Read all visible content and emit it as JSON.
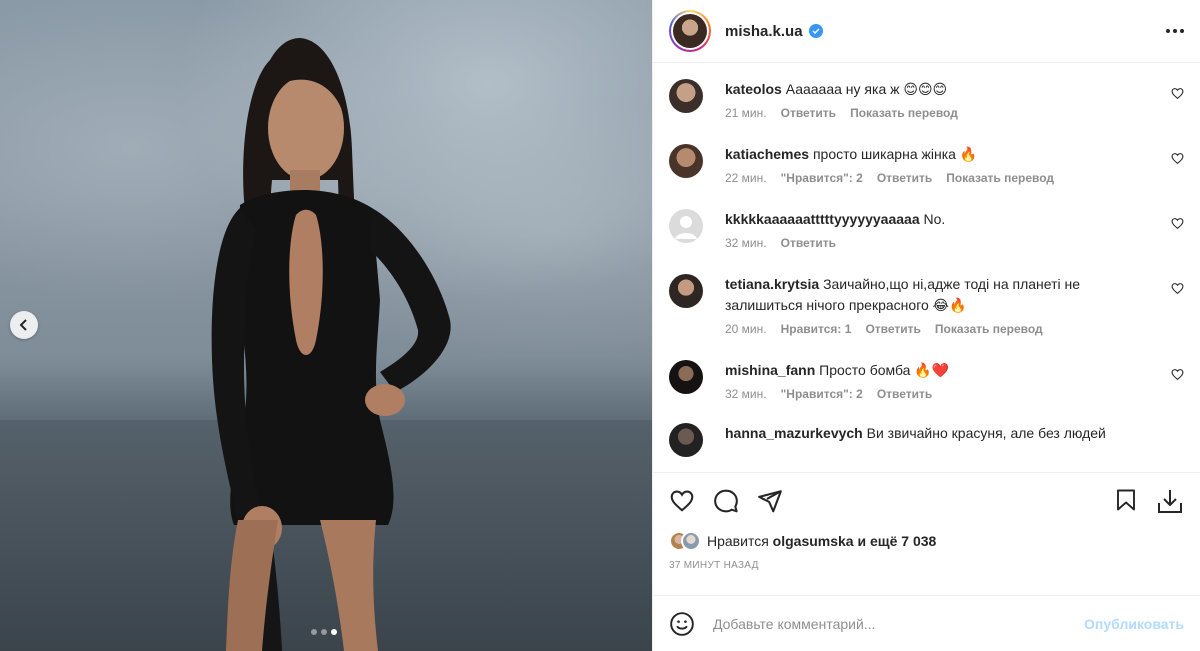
{
  "post": {
    "username": "misha.k.ua",
    "verified": true
  },
  "carousel": {
    "total": 3,
    "active": 3
  },
  "comments": [
    {
      "user": "kateolos",
      "text": "Ааааааа ну яка ж 😊😊😊",
      "time": "21 мин.",
      "likes_label": "",
      "reply": "Ответить",
      "translate": "Показать перевод"
    },
    {
      "user": "katiachemes",
      "text": "просто шикарна жінка 🔥",
      "time": "22 мин.",
      "likes_label": "\"Нравится\": 2",
      "reply": "Ответить",
      "translate": "Показать перевод"
    },
    {
      "user": "kkkkkaaaaaatttttyyyyyyaaaaa",
      "text": "No.",
      "time": "32 мин.",
      "likes_label": "",
      "reply": "Ответить",
      "translate": ""
    },
    {
      "user": "tetiana.krytsia",
      "text": "Заичайно,що ні,адже тоді на планеті не залишиться нічого прекрасного 😂🔥",
      "time": "20 мин.",
      "likes_label": "Нравится: 1",
      "reply": "Ответить",
      "translate": "Показать перевод"
    },
    {
      "user": "mishina_fann",
      "text": "Просто бомба 🔥❤️",
      "time": "32 мин.",
      "likes_label": "\"Нравится\": 2",
      "reply": "Ответить",
      "translate": ""
    },
    {
      "user": "hanna_mazurkevych",
      "text": "Ви звичайно красуня, але без людей",
      "time": "",
      "likes_label": "",
      "reply": "",
      "translate": ""
    }
  ],
  "likes": {
    "prefix": "Нравится",
    "user": "olgasumska",
    "suffix": "и ещё 7 038"
  },
  "time_ago": "37 МИНУТ НАЗАД",
  "add_comment": {
    "placeholder": "Добавьте комментарий...",
    "publish": "Опубликовать"
  },
  "colors": {
    "verified": "#3897f0",
    "publish_disabled": "#b3dbff",
    "meta_gray": "#8e8e8e"
  }
}
